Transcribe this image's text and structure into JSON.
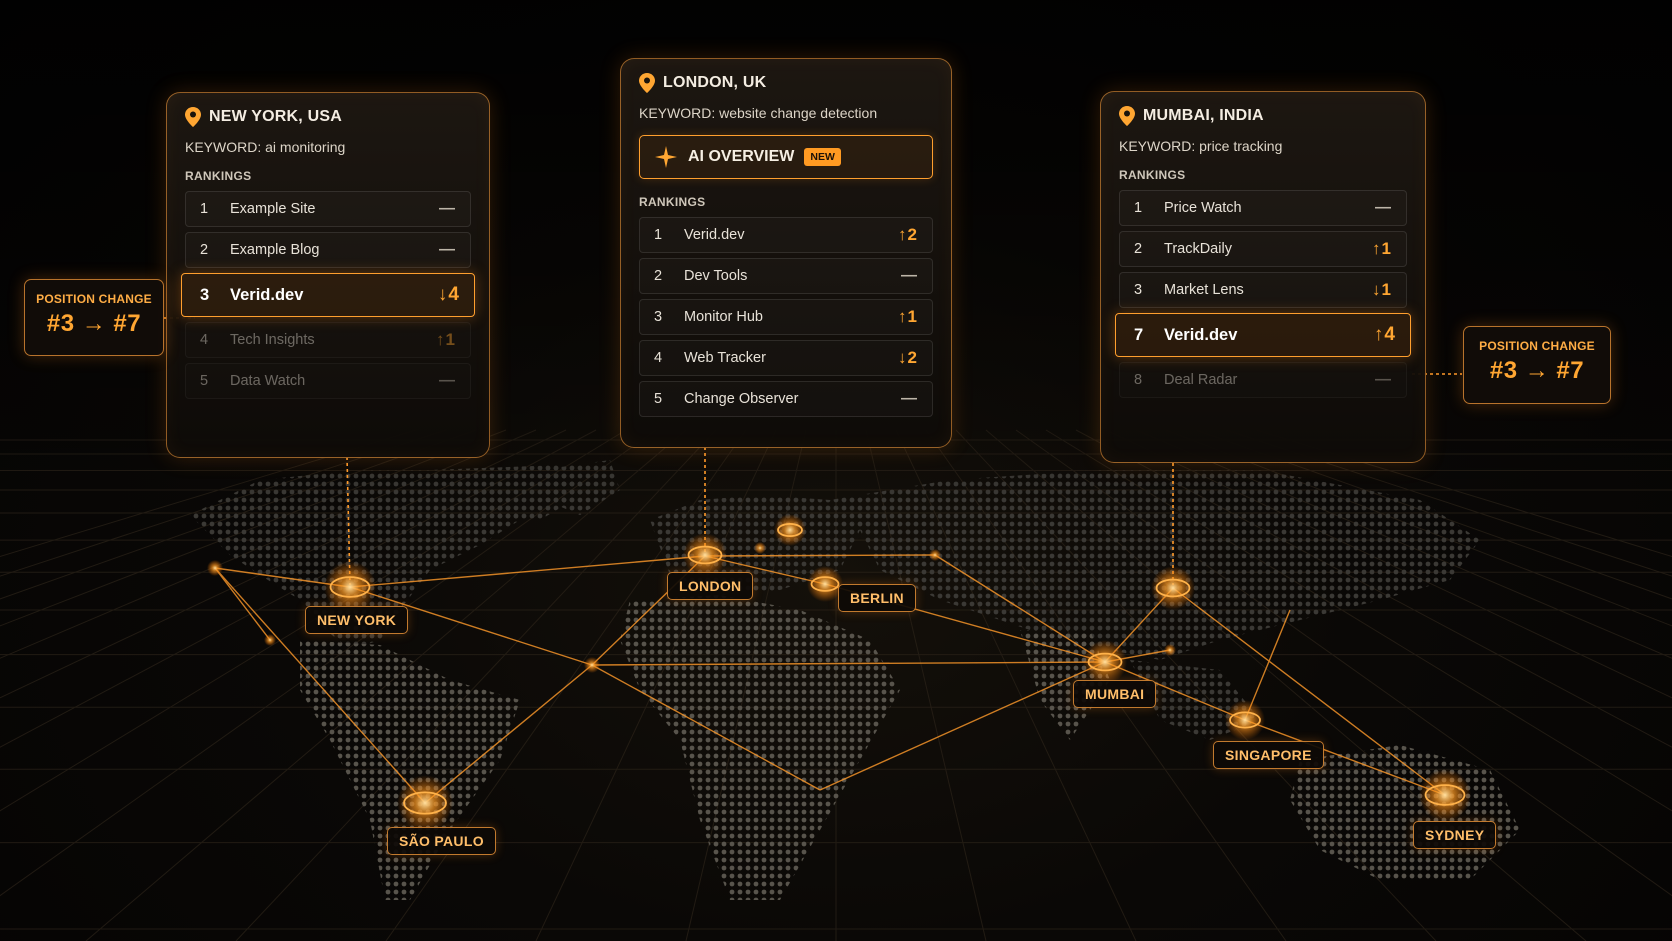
{
  "colors": {
    "accent": "#ff9f2e",
    "background": "#060504",
    "text": "#e8e2d8"
  },
  "cards": {
    "new_york": {
      "location": "NEW YORK, USA",
      "keyword": "KEYWORD: ai monitoring",
      "section": "RANKINGS",
      "rows": [
        {
          "rank": "1",
          "name": "Example Site",
          "change": "—"
        },
        {
          "rank": "2",
          "name": "Example Blog",
          "change": "—"
        },
        {
          "rank": "3",
          "name": "Verid.dev",
          "change": "↓4"
        },
        {
          "rank": "4",
          "name": "Tech Insights",
          "change": "↑1"
        },
        {
          "rank": "5",
          "name": "Data Watch",
          "change": "—"
        }
      ]
    },
    "london": {
      "location": "LONDON, UK",
      "keyword": "KEYWORD: website change detection",
      "ai_overview": "AI OVERVIEW",
      "ai_badge": "NEW",
      "section": "RANKINGS",
      "rows": [
        {
          "rank": "1",
          "name": "Verid.dev",
          "change": "↑2"
        },
        {
          "rank": "2",
          "name": "Dev Tools",
          "change": "—"
        },
        {
          "rank": "3",
          "name": "Monitor Hub",
          "change": "↑1"
        },
        {
          "rank": "4",
          "name": "Web Tracker",
          "change": "↓2"
        },
        {
          "rank": "5",
          "name": "Change Observer",
          "change": "—"
        }
      ]
    },
    "mumbai": {
      "location": "MUMBAI, INDIA",
      "keyword": "KEYWORD: price tracking",
      "section": "RANKINGS",
      "rows": [
        {
          "rank": "1",
          "name": "Price Watch",
          "change": "—"
        },
        {
          "rank": "2",
          "name": "TrackDaily",
          "change": "↑1"
        },
        {
          "rank": "3",
          "name": "Market Lens",
          "change": "↓1"
        },
        {
          "rank": "7",
          "name": "Verid.dev",
          "change": "↑4"
        },
        {
          "rank": "8",
          "name": "Deal Radar",
          "change": "—"
        }
      ]
    }
  },
  "position_change": {
    "left": {
      "label": "POSITION CHANGE",
      "value": "#3 → #7"
    },
    "right": {
      "label": "POSITION CHANGE",
      "value": "#3 → #7"
    }
  },
  "cities": {
    "new_york": "NEW YORK",
    "london": "LONDON",
    "berlin": "BERLIN",
    "mumbai": "MUMBAI",
    "singapore": "SINGAPORE",
    "sydney": "SYDNEY",
    "sao_paulo": "SÃO PAULO"
  }
}
